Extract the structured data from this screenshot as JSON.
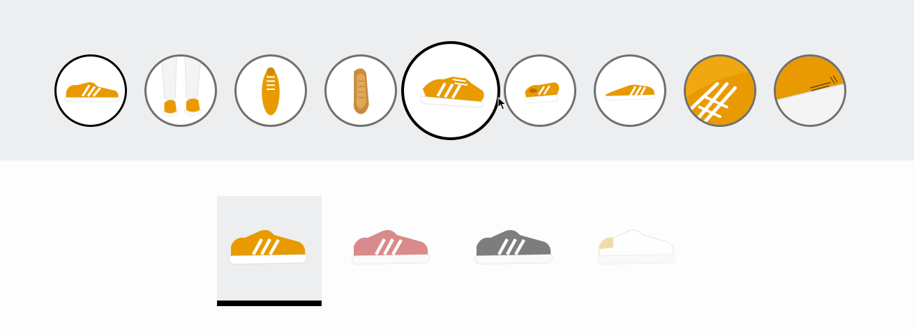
{
  "gallery": {
    "accent_color": "#e89a00",
    "active_index": 4,
    "views": [
      {
        "icon": "shoe-side-view-icon"
      },
      {
        "icon": "shoe-on-feet-icon"
      },
      {
        "icon": "shoe-top-view-icon"
      },
      {
        "icon": "shoe-sole-view-icon"
      },
      {
        "icon": "shoe-angled-view-icon"
      },
      {
        "icon": "shoe-back-view-icon"
      },
      {
        "icon": "shoe-medial-view-icon"
      },
      {
        "icon": "shoe-laces-closeup-icon"
      },
      {
        "icon": "shoe-heel-logo-closeup-icon"
      }
    ]
  },
  "colorways": {
    "selected_index": 0,
    "items": [
      {
        "icon": "shoe-colorway-icon",
        "color": "#e89a00"
      },
      {
        "icon": "shoe-colorway-icon",
        "color": "#d98a8a"
      },
      {
        "icon": "shoe-colorway-icon",
        "color": "#7d7d7d"
      },
      {
        "icon": "shoe-colorway-icon",
        "color": "#f2f2f2"
      }
    ]
  }
}
